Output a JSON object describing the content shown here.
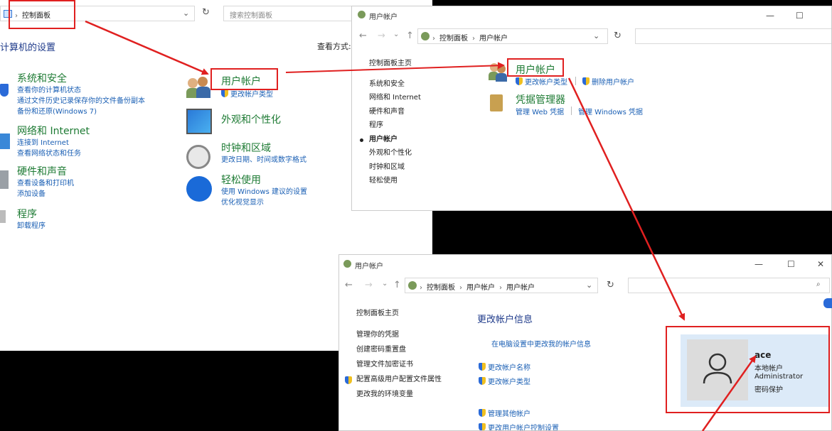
{
  "win1": {
    "breadcrumb": "控制面板",
    "search_placeholder": "搜索控制面板",
    "heading": "计算机的设置",
    "view_by": "查看方式:",
    "categories": [
      {
        "title": "系统和安全",
        "links": [
          "查看你的计算机状态",
          "通过文件历史记录保存你的文件备份副本",
          "备份和还原(Windows 7)"
        ]
      },
      {
        "title": "网络和 Internet",
        "links": [
          "连接到 Internet",
          "查看网络状态和任务"
        ]
      },
      {
        "title": "硬件和声音",
        "links": [
          "查看设备和打印机",
          "添加设备"
        ]
      },
      {
        "title": "程序",
        "links": [
          "卸载程序"
        ]
      }
    ],
    "categories_right": [
      {
        "title": "用户帐户",
        "links": [
          "更改帐户类型"
        ]
      },
      {
        "title": "外观和个性化",
        "links": []
      },
      {
        "title": "时钟和区域",
        "links": [
          "更改日期、时间或数字格式"
        ]
      },
      {
        "title": "轻松使用",
        "links": [
          "使用 Windows 建议的设置",
          "优化视觉显示"
        ]
      }
    ]
  },
  "win2": {
    "title": "用户帐户",
    "breadcrumb": [
      "控制面板",
      "用户帐户"
    ],
    "nav": [
      "控制面板主页",
      "系统和安全",
      "网络和 Internet",
      "硬件和声音",
      "程序",
      "用户帐户",
      "外观和个性化",
      "时钟和区域",
      "轻松使用"
    ],
    "sections": [
      {
        "title": "用户帐户",
        "links": [
          "更改帐户类型",
          "删除用户帐户"
        ]
      },
      {
        "title": "凭据管理器",
        "links": [
          "管理 Web 凭据",
          "管理 Windows 凭据"
        ]
      }
    ]
  },
  "win3": {
    "title": "用户帐户",
    "breadcrumb": [
      "控制面板",
      "用户帐户",
      "用户帐户"
    ],
    "nav": [
      "控制面板主页",
      "管理你的凭据",
      "创建密码重置盘",
      "管理文件加密证书",
      "配置高级用户配置文件属性",
      "更改我的环境变量"
    ],
    "heading": "更改帐户信息",
    "pc_settings_link": "在电脑设置中更改我的帐户信息",
    "actions": [
      "更改帐户名称",
      "更改帐户类型"
    ],
    "actions2": [
      "管理其他帐户",
      "更改用户帐户控制设置"
    ],
    "account": {
      "name": "ace",
      "lines": [
        "本地帐户",
        "Administrator",
        "密码保护"
      ]
    }
  },
  "colors": {
    "accent_red": "#e02020",
    "link_blue": "#1a5fb4",
    "title_green": "#1e7b34"
  }
}
